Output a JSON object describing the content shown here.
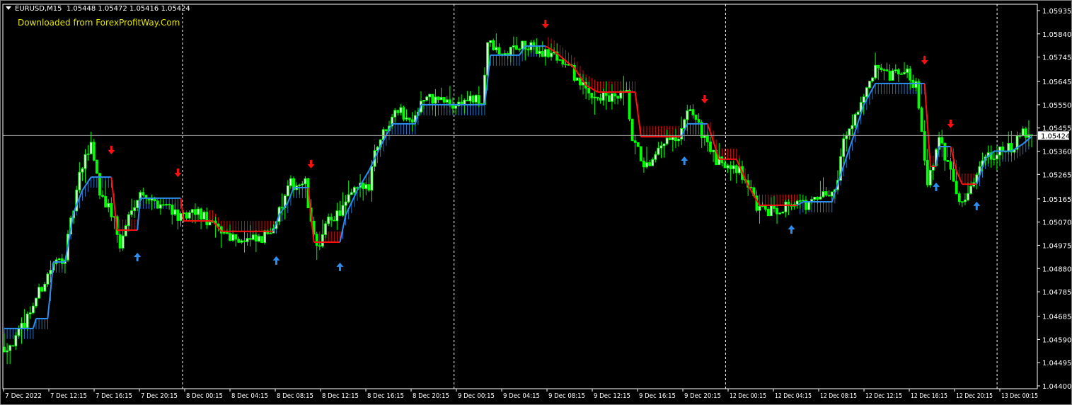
{
  "header": {
    "symbol": "EURUSD,M15",
    "ohlc": "1.05448 1.05472 1.05416 1.05424",
    "watermark": "Downloaded from ForexProfitWay.Com"
  },
  "colors": {
    "background": "#000000",
    "bull_candle": "#00ff00",
    "bear_candle": "#00ff00",
    "trend_up": "#2b8ef0",
    "trend_down": "#ff1010",
    "grid_separator": "#ffffff",
    "current_price_line": "#a0a0a0",
    "axis_text": "#ffffff"
  },
  "chart_data": {
    "type": "candlestick",
    "symbol": "EURUSD",
    "timeframe": "M15",
    "bar_count": 356,
    "ylim": [
      1.044,
      1.05935
    ],
    "current_price": 1.05424,
    "current_price_label": "1.05424",
    "y_ticks": [
      "1.05935",
      "1.05840",
      "1.05745",
      "1.05645",
      "1.05550",
      "1.05455",
      "1.05360",
      "1.05265",
      "1.05165",
      "1.05070",
      "1.04975",
      "1.04880",
      "1.04785",
      "1.04685",
      "1.04590",
      "1.04495",
      "1.04400"
    ],
    "x_ticks": [
      "7 Dec 2022",
      "7 Dec 12:15",
      "7 Dec 16:15",
      "7 Dec 20:15",
      "8 Dec 00:15",
      "8 Dec 04:15",
      "8 Dec 08:15",
      "8 Dec 12:15",
      "8 Dec 16:15",
      "8 Dec 20:15",
      "9 Dec 00:15",
      "9 Dec 04:15",
      "9 Dec 08:15",
      "9 Dec 12:15",
      "9 Dec 16:15",
      "9 Dec 20:15",
      "12 Dec 00:15",
      "12 Dec 04:15",
      "12 Dec 08:15",
      "12 Dec 12:15",
      "12 Dec 16:15",
      "12 Dec 20:15",
      "13 Dec 00:15"
    ],
    "price_path": [
      [
        0,
        1.04559
      ],
      [
        4,
        1.04588
      ],
      [
        10,
        1.04733
      ],
      [
        16,
        1.04878
      ],
      [
        21,
        1.04936
      ],
      [
        26,
        1.05254
      ],
      [
        30,
        1.05399
      ],
      [
        33,
        1.05197
      ],
      [
        38,
        1.05081
      ],
      [
        40,
        1.04965
      ],
      [
        44,
        1.05139
      ],
      [
        48,
        1.05197
      ],
      [
        51,
        1.05153
      ],
      [
        57,
        1.05139
      ],
      [
        61,
        1.05081
      ],
      [
        67,
        1.0511
      ],
      [
        72,
        1.05052
      ],
      [
        77,
        1.05023
      ],
      [
        83,
        1.04994
      ],
      [
        89,
        1.04994
      ],
      [
        94,
        1.05081
      ],
      [
        99,
        1.05225
      ],
      [
        104,
        1.05225
      ],
      [
        106,
        1.05052
      ],
      [
        109,
        1.04965
      ],
      [
        112,
        1.05081
      ],
      [
        116,
        1.0511
      ],
      [
        121,
        1.05197
      ],
      [
        126,
        1.05225
      ],
      [
        128,
        1.0537
      ],
      [
        132,
        1.05457
      ],
      [
        135,
        1.05544
      ],
      [
        140,
        1.05486
      ],
      [
        145,
        1.05573
      ],
      [
        150,
        1.05573
      ],
      [
        155,
        1.05544
      ],
      [
        160,
        1.05573
      ],
      [
        165,
        1.05559
      ],
      [
        167,
        1.05805
      ],
      [
        172,
        1.05747
      ],
      [
        177,
        1.0579
      ],
      [
        184,
        1.05776
      ],
      [
        191,
        1.05747
      ],
      [
        196,
        1.05689
      ],
      [
        201,
        1.05602
      ],
      [
        209,
        1.05573
      ],
      [
        215,
        1.05588
      ],
      [
        217,
        1.05399
      ],
      [
        221,
        1.05312
      ],
      [
        223,
        1.05283
      ],
      [
        228,
        1.05399
      ],
      [
        233,
        1.05399
      ],
      [
        237,
        1.05544
      ],
      [
        240,
        1.05457
      ],
      [
        243,
        1.05399
      ],
      [
        246,
        1.05312
      ],
      [
        252,
        1.05312
      ],
      [
        257,
        1.05225
      ],
      [
        261,
        1.0511
      ],
      [
        267,
        1.05124
      ],
      [
        272,
        1.05153
      ],
      [
        277,
        1.05139
      ],
      [
        282,
        1.05168
      ],
      [
        287,
        1.05197
      ],
      [
        290,
        1.05399
      ],
      [
        294,
        1.05515
      ],
      [
        298,
        1.05602
      ],
      [
        301,
        1.05689
      ],
      [
        306,
        1.0566
      ],
      [
        311,
        1.05689
      ],
      [
        315,
        1.05631
      ],
      [
        317,
        1.05457
      ],
      [
        319,
        1.05225
      ],
      [
        323,
        1.05399
      ],
      [
        327,
        1.05283
      ],
      [
        330,
        1.05168
      ],
      [
        334,
        1.05197
      ],
      [
        338,
        1.05341
      ],
      [
        343,
        1.05356
      ],
      [
        348,
        1.0537
      ],
      [
        352,
        1.05428
      ],
      [
        355,
        1.05424
      ]
    ],
    "trend_line": [
      [
        0,
        1.04635,
        "up"
      ],
      [
        10,
        1.04635,
        "up"
      ],
      [
        11,
        1.04675,
        "up"
      ],
      [
        15,
        1.04675,
        "up"
      ],
      [
        17,
        1.04907,
        "up"
      ],
      [
        21,
        1.04907,
        "up"
      ],
      [
        24,
        1.0511,
        "up"
      ],
      [
        27,
        1.052,
        "up"
      ],
      [
        30,
        1.05254,
        "up"
      ],
      [
        37,
        1.05254,
        "up"
      ],
      [
        39,
        1.05037,
        "down"
      ],
      [
        46,
        1.05037,
        "down"
      ],
      [
        47,
        1.05168,
        "up"
      ],
      [
        61,
        1.05168,
        "up"
      ],
      [
        62,
        1.05075,
        "down"
      ],
      [
        72,
        1.05075,
        "down"
      ],
      [
        75,
        1.05032,
        "down"
      ],
      [
        93,
        1.05032,
        "down"
      ],
      [
        95,
        1.051,
        "up"
      ],
      [
        98,
        1.0515,
        "up"
      ],
      [
        100,
        1.05211,
        "up"
      ],
      [
        105,
        1.05211,
        "up"
      ],
      [
        107,
        1.04988,
        "down"
      ],
      [
        116,
        1.04988,
        "down"
      ],
      [
        118,
        1.051,
        "up"
      ],
      [
        122,
        1.052,
        "up"
      ],
      [
        126,
        1.0528,
        "up"
      ],
      [
        130,
        1.0538,
        "up"
      ],
      [
        134,
        1.05472,
        "up"
      ],
      [
        142,
        1.05472,
        "up"
      ],
      [
        144,
        1.0555,
        "up"
      ],
      [
        166,
        1.0555,
        "up"
      ],
      [
        168,
        1.05753,
        "up"
      ],
      [
        178,
        1.05753,
        "up"
      ],
      [
        180,
        1.0579,
        "up"
      ],
      [
        187,
        1.0579,
        "up"
      ],
      [
        190,
        1.0577,
        "down"
      ],
      [
        197,
        1.057,
        "down"
      ],
      [
        201,
        1.0563,
        "down"
      ],
      [
        205,
        1.05602,
        "down"
      ],
      [
        218,
        1.05602,
        "down"
      ],
      [
        220,
        1.05419,
        "down"
      ],
      [
        234,
        1.05419,
        "down"
      ],
      [
        236,
        1.05472,
        "up"
      ],
      [
        243,
        1.05472,
        "up"
      ],
      [
        245,
        1.054,
        "down"
      ],
      [
        247,
        1.05327,
        "down"
      ],
      [
        253,
        1.05327,
        "down"
      ],
      [
        257,
        1.0522,
        "down"
      ],
      [
        261,
        1.05139,
        "down"
      ],
      [
        274,
        1.05139,
        "down"
      ],
      [
        276,
        1.05153,
        "up"
      ],
      [
        286,
        1.05153,
        "up"
      ],
      [
        290,
        1.053,
        "up"
      ],
      [
        294,
        1.0544,
        "up"
      ],
      [
        297,
        1.0555,
        "up"
      ],
      [
        301,
        1.05637,
        "up"
      ],
      [
        318,
        1.05637,
        "up"
      ],
      [
        320,
        1.05298,
        "down"
      ],
      [
        322,
        1.05298,
        "down"
      ],
      [
        323,
        1.05379,
        "up"
      ],
      [
        327,
        1.05379,
        "up"
      ],
      [
        329,
        1.0528,
        "down"
      ],
      [
        331,
        1.05225,
        "down"
      ],
      [
        336,
        1.05225,
        "down"
      ],
      [
        339,
        1.0533,
        "up"
      ],
      [
        342,
        1.0536,
        "up"
      ],
      [
        348,
        1.0536,
        "up"
      ],
      [
        352,
        1.0539,
        "up"
      ],
      [
        355,
        1.0542,
        "up"
      ]
    ],
    "sell_arrows": [
      [
        37,
        1.05362
      ],
      [
        60,
        1.05269
      ],
      [
        106,
        1.05304
      ],
      [
        187,
        1.05877
      ],
      [
        242,
        1.0557
      ],
      [
        318,
        1.05729
      ],
      [
        327,
        1.05469
      ]
    ],
    "buy_arrows": [
      [
        46,
        1.0493
      ],
      [
        94,
        1.04916
      ],
      [
        116,
        1.0489
      ],
      [
        235,
        1.05324
      ],
      [
        272,
        1.05043
      ],
      [
        322,
        1.05217
      ],
      [
        336,
        1.05139
      ]
    ]
  }
}
